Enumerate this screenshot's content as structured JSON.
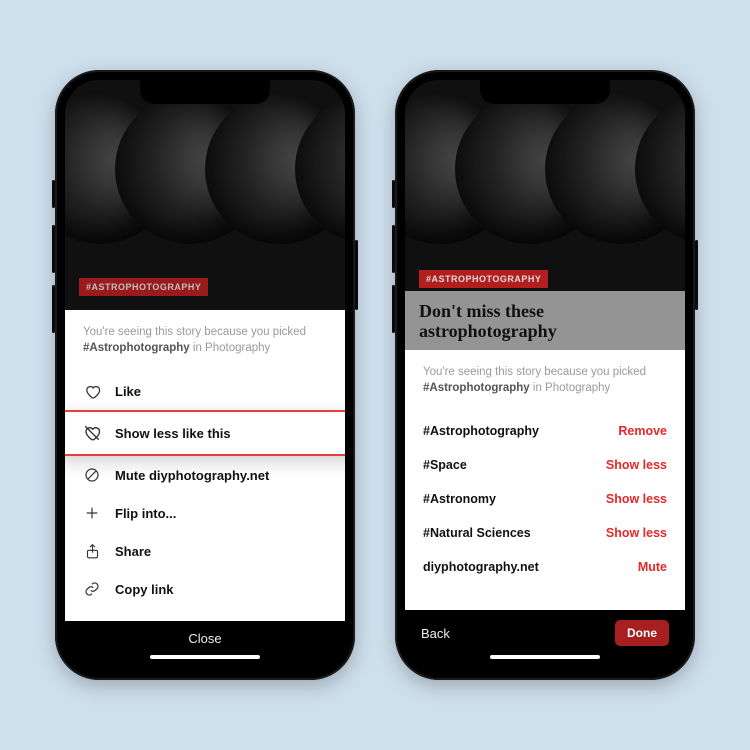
{
  "left": {
    "tag": "#ASTROPHOTOGRAPHY",
    "reason_prefix": "You're seeing this story because you picked ",
    "reason_topic": "#Astrophotography",
    "reason_suffix": " in Photography",
    "menu": {
      "like": "Like",
      "show_less": "Show less like this",
      "mute": "Mute diyphotography.net",
      "flip": "Flip into...",
      "share": "Share",
      "copy": "Copy link"
    },
    "close": "Close"
  },
  "right": {
    "tag": "#ASTROPHOTOGRAPHY",
    "headline": "Don't miss these astrophotography",
    "reason_prefix": "You're seeing this story because you picked ",
    "reason_topic": "#Astrophotography",
    "reason_suffix": " in Photography",
    "topics": [
      {
        "name": "#Astrophotography",
        "action": "Remove"
      },
      {
        "name": "#Space",
        "action": "Show less"
      },
      {
        "name": "#Astronomy",
        "action": "Show less"
      },
      {
        "name": "#Natural Sciences",
        "action": "Show less"
      },
      {
        "name": "diyphotography.net",
        "action": "Mute"
      }
    ],
    "back": "Back",
    "done": "Done"
  }
}
